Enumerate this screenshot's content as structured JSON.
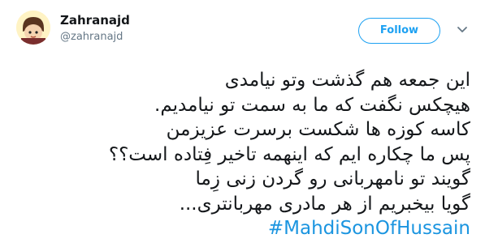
{
  "user": {
    "display_name": "Zahranajd",
    "handle": "@zahranajd",
    "avatar_icon": "cartoon-face-avatar"
  },
  "actions": {
    "follow_label": "Follow",
    "more_icon": "chevron-down-icon"
  },
  "tweet": {
    "lines": [
      "این جمعه هم گذشت وتو نیامدی",
      "هیچکس نگفت که ما به سمت تو نیامدیم.",
      "کاسه کوزه ها شکست برسرت عزیزمن",
      "پس ما چکاره ایم که اینهمه تاخیر فِتاده است؟؟",
      "گویند تو نامهربانی رو گردن زنی زِما",
      "گویا بیخبریم از هر مادری مهربانتری..."
    ],
    "hashtag": "#MahdiSonOfHussain"
  },
  "colors": {
    "accent": "#1da1f2",
    "hashtag": "#1b95e0",
    "text": "#14171a",
    "muted": "#657786"
  }
}
